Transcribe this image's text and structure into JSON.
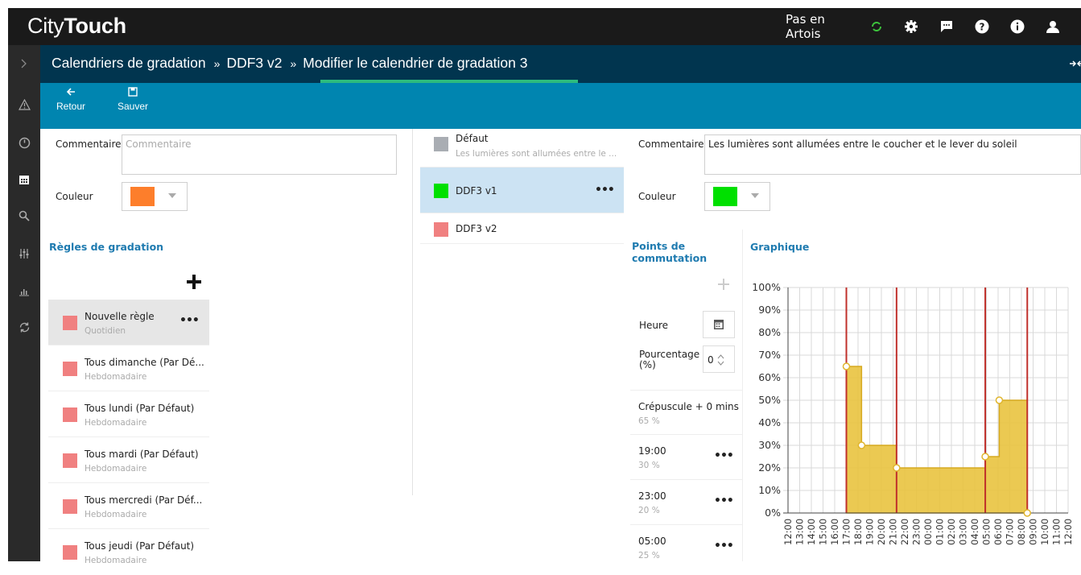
{
  "app": {
    "logo_light": "City",
    "logo_bold": "Touch",
    "location": "Pas en Artois"
  },
  "breadcrumbs": {
    "items": [
      "Calendriers de gradation",
      "DDF3 v2",
      "Modifier le calendrier de gradation 3"
    ],
    "separator": "»"
  },
  "toolbar": {
    "back_label": "Retour",
    "save_label": "Sauver"
  },
  "left_form": {
    "comment_label": "Commentaire",
    "comment_placeholder": "Commentaire",
    "color_label": "Couleur",
    "color_value": "#fd7e2b"
  },
  "rules": {
    "title": "Règles de gradation",
    "items": [
      {
        "name": "Nouvelle règle",
        "type": "Quotidien",
        "selected": true
      },
      {
        "name": "Tous dimanche (Par Dé...",
        "type": "Hebdomadaire"
      },
      {
        "name": "Tous lundi (Par Défaut)",
        "type": "Hebdomadaire"
      },
      {
        "name": "Tous mardi (Par Défaut)",
        "type": "Hebdomadaire"
      },
      {
        "name": "Tous mercredi (Par Déf...",
        "type": "Hebdomadaire"
      },
      {
        "name": "Tous jeudi (Par Défaut)",
        "type": "Hebdomadaire"
      }
    ]
  },
  "calendars": {
    "items": [
      {
        "name": "Défaut",
        "desc": "Les lumières sont allumées entre le ...",
        "color": "#a9adb3"
      },
      {
        "name": "DDF3 v1",
        "desc": "",
        "color": "#00e000",
        "selected": true
      },
      {
        "name": "DDF3 v2",
        "desc": "",
        "color": "#f08080"
      }
    ]
  },
  "right_form": {
    "comment_label": "Commentaire",
    "comment_value": "Les lumières sont allumées entre le coucher et le lever du soleil",
    "color_label": "Couleur",
    "color_value": "#00e000"
  },
  "points": {
    "title_line1": "Points de",
    "title_line2": "commutation",
    "hour_label": "Heure",
    "percent_label_line1": "Pourcentage",
    "percent_label_line2": "(%)",
    "percent_value": "0",
    "items": [
      {
        "time": "Crépuscule + 0 mins",
        "pct": "65 %"
      },
      {
        "time": "19:00",
        "pct": "30 %"
      },
      {
        "time": "23:00",
        "pct": "20 %"
      },
      {
        "time": "05:00",
        "pct": "25 %"
      }
    ]
  },
  "graph": {
    "title": "Graphique"
  },
  "chart_data": {
    "type": "area",
    "x_labels": [
      "12:00",
      "13:00",
      "14:00",
      "15:00",
      "16:00",
      "17:00",
      "18:00",
      "19:00",
      "20:00",
      "21:00",
      "22:00",
      "23:00",
      "00:00",
      "01:00",
      "02:00",
      "03:00",
      "04:00",
      "05:00",
      "06:00",
      "07:00",
      "08:00",
      "09:00",
      "10:00",
      "11:00",
      "12:00"
    ],
    "y_ticks": [
      "0%",
      "10%",
      "20%",
      "30%",
      "40%",
      "50%",
      "60%",
      "70%",
      "80%",
      "90%",
      "100%"
    ],
    "ylim": [
      0,
      100
    ],
    "steps": [
      {
        "x": 5,
        "y": 65
      },
      {
        "x": 6.3,
        "y": 30
      },
      {
        "x": 9.3,
        "y": 20
      },
      {
        "x": 16.9,
        "y": 25
      },
      {
        "x": 18.1,
        "y": 50
      },
      {
        "x": 20.5,
        "y": 0
      }
    ],
    "red_lines": [
      5,
      9.3,
      16.9,
      20.5
    ],
    "fill_color": "#e8c13a",
    "red_color": "#c0302b"
  }
}
